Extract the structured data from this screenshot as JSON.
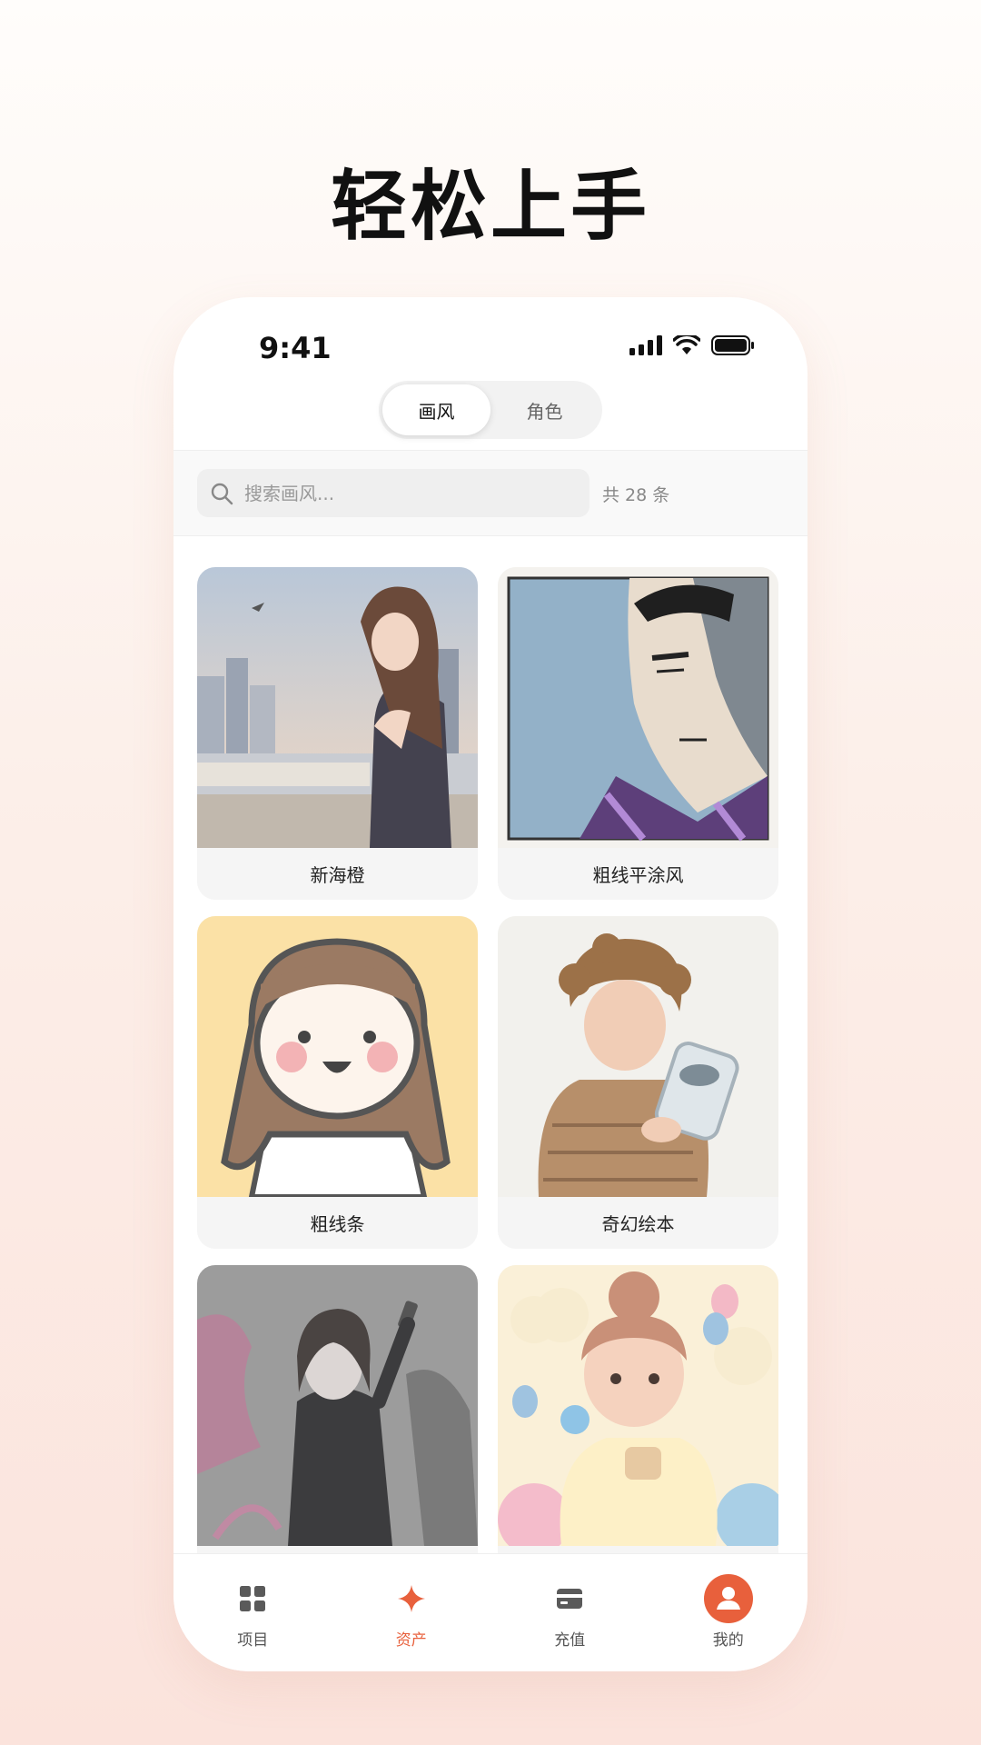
{
  "hero": {
    "title": "轻松上手"
  },
  "status_bar": {
    "time": "9:41"
  },
  "segment": {
    "tabs": [
      {
        "label": "画风",
        "active": true
      },
      {
        "label": "角色",
        "active": false
      }
    ]
  },
  "search": {
    "placeholder": "搜索画风...",
    "value": "",
    "count_text": "共 28 条"
  },
  "styles": [
    {
      "label": "新海橙"
    },
    {
      "label": "粗线平涂风"
    },
    {
      "label": "粗线条"
    },
    {
      "label": "奇幻绘本"
    },
    {
      "label": ""
    },
    {
      "label": ""
    }
  ],
  "tab_bar": {
    "items": [
      {
        "label": "项目",
        "icon": "grid-icon",
        "active": false
      },
      {
        "label": "资产",
        "icon": "sparkle-icon",
        "active": true
      },
      {
        "label": "充值",
        "icon": "card-icon",
        "active": false
      },
      {
        "label": "我的",
        "icon": "user-icon",
        "active": false
      }
    ]
  },
  "colors": {
    "accent": "#e8603c",
    "background_top": "#fffdfb",
    "background_bottom": "#fbe3dc"
  }
}
